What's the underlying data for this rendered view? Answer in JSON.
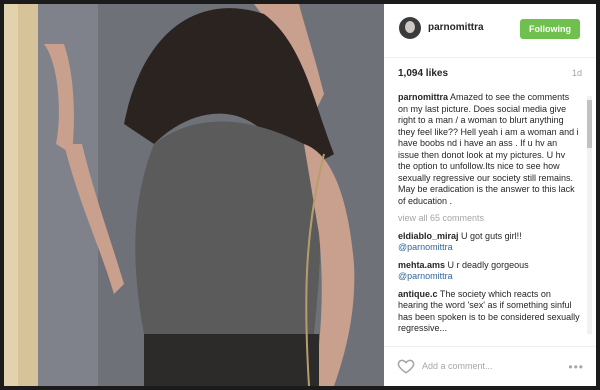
{
  "post": {
    "username": "parnomittra",
    "follow_label": "Following",
    "likes": "1,094 likes",
    "time_ago": "1d"
  },
  "caption": {
    "author": "parnomittra",
    "text": "Amazed to see the comments on my last picture. Does social media give right to a man / a woman to blurt anything they feel like?? Hell yeah i am a woman and i have boobs nd i have an ass . If u hv an issue then donot look at my pictures. U hv the option to unfollow.Its nice to see how sexually regressive our society still remains. May be eradication is the answer to this lack of education ."
  },
  "view_all": "view all 65 comments",
  "comments": [
    {
      "user": "eldiablo_miraj",
      "text": "U got guts girl!!",
      "mention": "@parnomittra"
    },
    {
      "user": "mehta.ams",
      "text": "U r deadly gorgeous",
      "mention": "@parnomittra"
    },
    {
      "user": "antique.c",
      "text": "The society which reacts on hearing the word 'sex' as if something sinful has been spoken is to be considered sexually regressive...",
      "mention": ""
    }
  ],
  "add_comment_placeholder": "Add a comment...",
  "more_label": "•••",
  "colors": {
    "follow_green": "#70c050",
    "mention_blue": "#336699"
  }
}
